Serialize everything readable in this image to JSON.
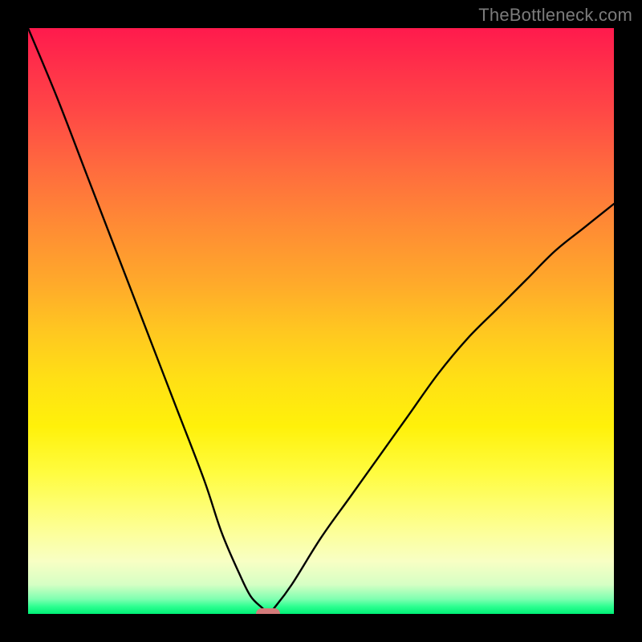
{
  "watermark": {
    "text": "TheBottleneck.com"
  },
  "chart_data": {
    "type": "line",
    "title": "",
    "xlabel": "",
    "ylabel": "",
    "xlim": [
      0,
      100
    ],
    "ylim": [
      0,
      100
    ],
    "grid": false,
    "legend": false,
    "series": [
      {
        "name": "bottleneck-curve",
        "x": [
          0,
          5,
          10,
          15,
          20,
          25,
          30,
          33,
          36,
          38,
          40,
          41,
          42,
          45,
          50,
          55,
          60,
          65,
          70,
          75,
          80,
          85,
          90,
          95,
          100
        ],
        "values": [
          100,
          88,
          75,
          62,
          49,
          36,
          23,
          14,
          7,
          3,
          1,
          0,
          1,
          5,
          13,
          20,
          27,
          34,
          41,
          47,
          52,
          57,
          62,
          66,
          70
        ]
      }
    ],
    "marker": {
      "x": 41,
      "y": 0,
      "color": "#d47a7a",
      "shape": "pill"
    },
    "background_gradient_stops": [
      {
        "pos": 0,
        "color": "#ff1a4d"
      },
      {
        "pos": 25,
        "color": "#ff6b3e"
      },
      {
        "pos": 50,
        "color": "#ffc820"
      },
      {
        "pos": 75,
        "color": "#fffc40"
      },
      {
        "pos": 95,
        "color": "#d6ffc4"
      },
      {
        "pos": 100,
        "color": "#00f076"
      }
    ]
  }
}
